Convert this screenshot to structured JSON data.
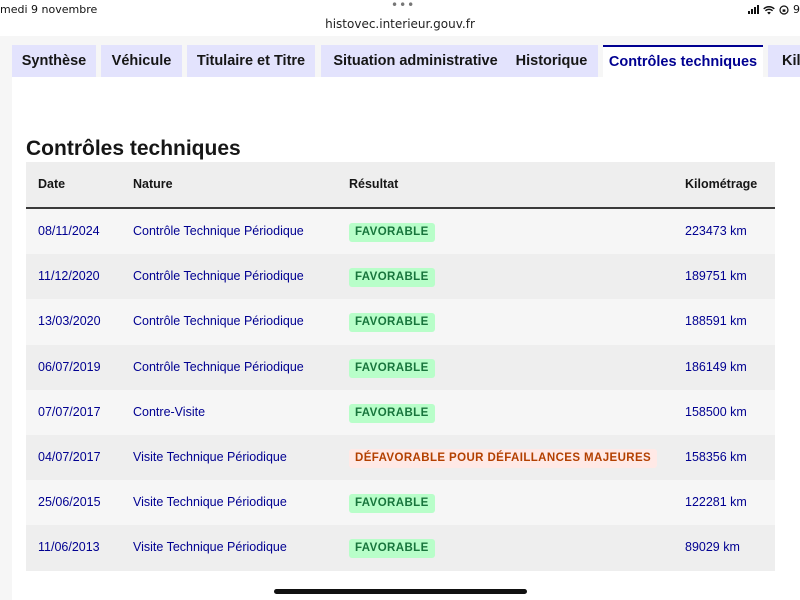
{
  "status_bar": {
    "date": "medi 9 novembre",
    "dots": "•••",
    "battery": "9"
  },
  "browser": {
    "url": "histovec.interieur.gouv.fr"
  },
  "tabs": [
    {
      "label": "Synthèse",
      "active": false
    },
    {
      "label": "Véhicule",
      "active": false
    },
    {
      "label": "Titulaire et Titre",
      "active": false
    },
    {
      "label": "Situation administrative",
      "active": false
    },
    {
      "label": "Historique",
      "active": false
    },
    {
      "label": "Contrôles techniques",
      "active": true
    },
    {
      "label": "Kil",
      "active": false
    }
  ],
  "section": {
    "title": "Contrôles techniques"
  },
  "table": {
    "headers": {
      "date": "Date",
      "nature": "Nature",
      "result": "Résultat",
      "km": "Kilométrage"
    },
    "rows": [
      {
        "date": "08/11/2024",
        "nature": "Contrôle Technique Périodique",
        "result": "FAVORABLE",
        "result_status": "favorable",
        "km": "223473 km"
      },
      {
        "date": "11/12/2020",
        "nature": "Contrôle Technique Périodique",
        "result": "FAVORABLE",
        "result_status": "favorable",
        "km": "189751 km"
      },
      {
        "date": "13/03/2020",
        "nature": "Contrôle Technique Périodique",
        "result": "FAVORABLE",
        "result_status": "favorable",
        "km": "188591 km"
      },
      {
        "date": "06/07/2019",
        "nature": "Contrôle Technique Périodique",
        "result": "FAVORABLE",
        "result_status": "favorable",
        "km": "186149 km"
      },
      {
        "date": "07/07/2017",
        "nature": "Contre-Visite",
        "result": "FAVORABLE",
        "result_status": "favorable",
        "km": "158500 km"
      },
      {
        "date": "04/07/2017",
        "nature": "Visite Technique Périodique",
        "result": "DÉFAVORABLE POUR DÉFAILLANCES MAJEURES",
        "result_status": "defavorable",
        "km": "158356 km"
      },
      {
        "date": "25/06/2015",
        "nature": "Visite Technique Périodique",
        "result": "FAVORABLE",
        "result_status": "favorable",
        "km": "122281 km"
      },
      {
        "date": "11/06/2013",
        "nature": "Visite Technique Périodique",
        "result": "FAVORABLE",
        "result_status": "favorable",
        "km": "89029 km"
      }
    ]
  },
  "colors": {
    "accent": "#000091",
    "tab_bg": "#e3e3fd",
    "success_bg": "#b8fec9",
    "success_text": "#18753c",
    "error_bg": "#ffe9e6",
    "error_text": "#b34000"
  }
}
